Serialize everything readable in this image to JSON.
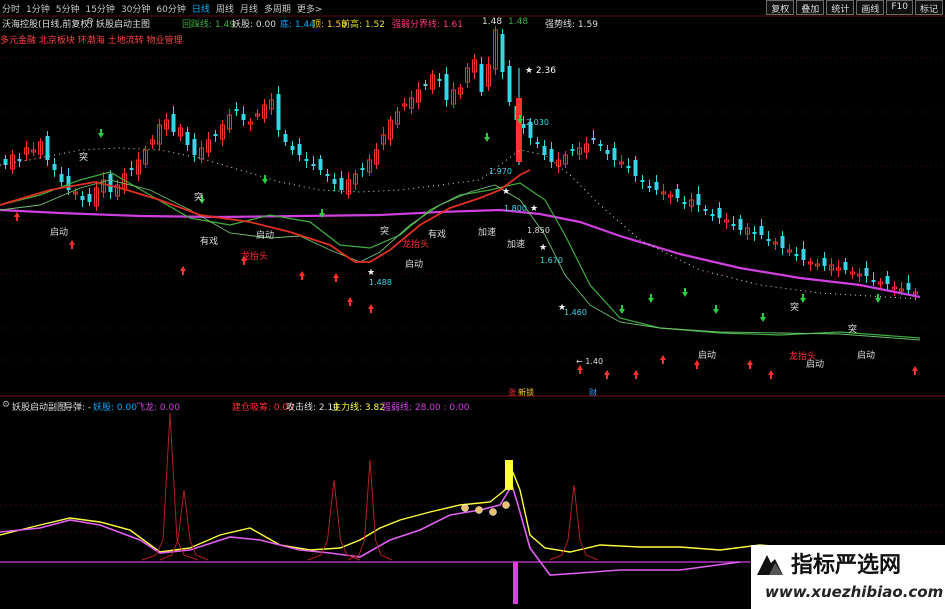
{
  "toolbar": {
    "periods": [
      "分时",
      "1分钟",
      "5分钟",
      "15分钟",
      "30分钟",
      "60分钟",
      "日线",
      "周线",
      "月线",
      "多周期",
      "更多>"
    ],
    "active_period": "日线",
    "buttons": [
      "复权",
      "叠加",
      "统计",
      "画线",
      "F10",
      "标记"
    ]
  },
  "upper": {
    "stock_name": "沃海控股(日线,前复权)",
    "indicator_name": "妖股启动主图",
    "huicai": "回踩线: 1.49",
    "yaogu": "妖股: 0.00",
    "di": "底: 1.44",
    "ding": "顶: 1.50",
    "qiangao": "前高: 1.52",
    "qiangruo": "强弱分界线: 1.61",
    "v148a": "1.48",
    "v148b": "1.48",
    "qiangshi": "强势线: 1.59",
    "concepts": "多元金融 北京板块 环渤海 土地流转 物业管理"
  },
  "lower": {
    "indicator_name": "妖股启动副图",
    "daodan": "导弹: -",
    "yaogu": "妖股: 0.00",
    "feilong": "飞龙: 0.00",
    "zhucang": "建仓吸筹: 0.00",
    "gongji": "攻击线: 2.10",
    "zhuli": "主力线: 3.82",
    "qiangruo": "强弱线: 28.00 : 0.00"
  },
  "chart_labels": {
    "high_price": "2.36",
    "low_price": "1.40",
    "price_2030": "2.030",
    "price_1850": "1.850",
    "price_1670": "1.670",
    "price_1460": "1.460",
    "price_1488": "1.488",
    "price_1800": "1.800",
    "price_1970": "1.970",
    "qidong": "启动",
    "youxi": "有戏",
    "tu": "突",
    "jiasu": "加速",
    "longtaitou": "龙抬头",
    "zhang": "涨",
    "xindu": "新锁",
    "cai": "财"
  },
  "colors": {
    "bull": "#ff3030",
    "bear": "#36d6e7",
    "ma_magenta": "#d040e0",
    "ma_green": "#3fae3f",
    "ma_red": "#e03020",
    "yellow": "#ffff40"
  },
  "watermark": {
    "title": "指标严选网",
    "url": "www.xuezhibiao.com"
  }
}
